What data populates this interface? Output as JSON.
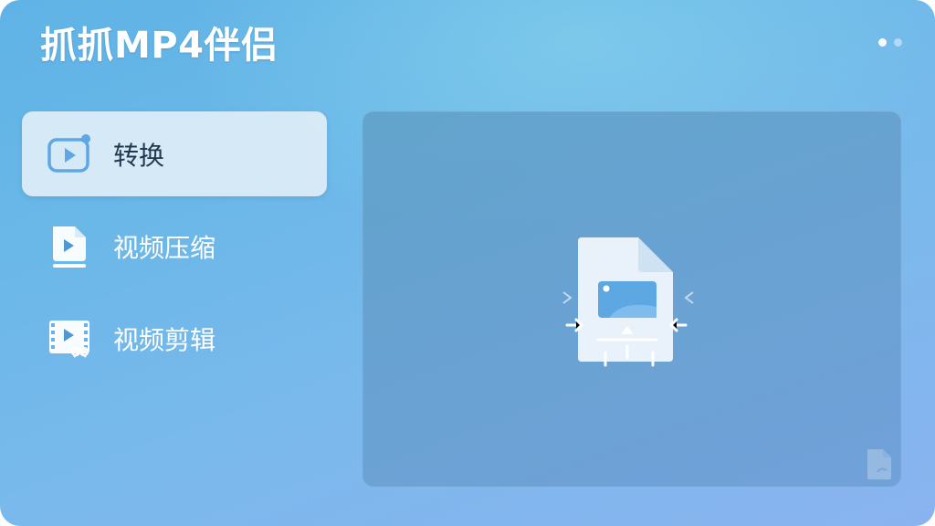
{
  "app": {
    "title": "抓抓MP4伴侣",
    "page_indicator": {
      "count": 2,
      "active": 1
    }
  },
  "sidebar": {
    "items": [
      {
        "label": "转换",
        "icon": "video-convert-icon",
        "active": true
      },
      {
        "label": "视频压缩",
        "icon": "video-file-compress-icon",
        "active": false
      },
      {
        "label": "视频剪辑",
        "icon": "video-edit-icon",
        "active": false
      }
    ]
  },
  "main": {
    "drop_zone": {
      "icon": "file-drop-icon"
    },
    "corner_icon": "document-icon"
  },
  "colors": {
    "accent": "#5fa7e3",
    "active_item_bg": "#e2eef7",
    "active_text": "#22384f",
    "panel_bg": "#659ec9"
  }
}
